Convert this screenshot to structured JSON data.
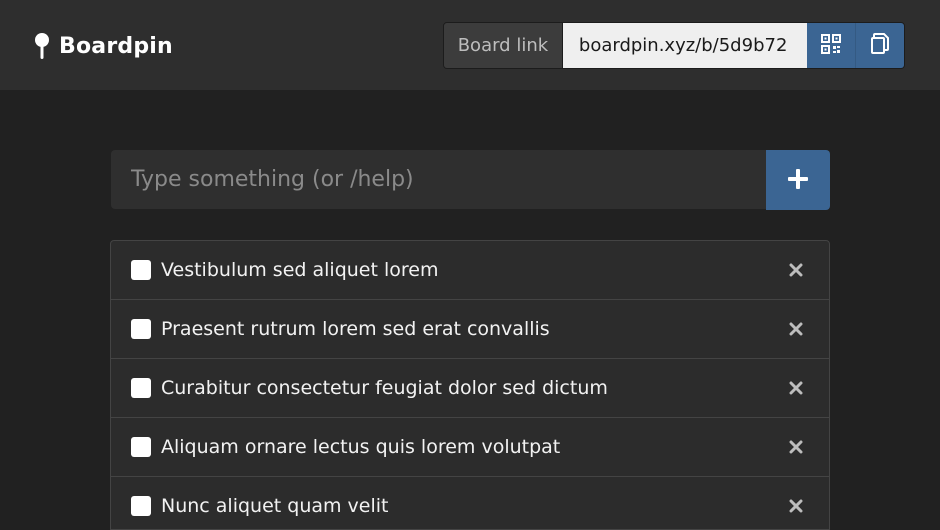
{
  "app": {
    "name": "Boardpin"
  },
  "board_link": {
    "label": "Board link",
    "url": "boardpin.xyz/b/5d9b72",
    "qr_icon": "qr-code-icon",
    "copy_icon": "copy-icon"
  },
  "composer": {
    "placeholder": "Type something (or /help)",
    "add_icon": "plus-icon"
  },
  "items": [
    {
      "text": "Vestibulum sed aliquet lorem",
      "checked": false
    },
    {
      "text": "Praesent rutrum lorem sed erat convallis",
      "checked": false
    },
    {
      "text": "Curabitur consectetur feugiat dolor sed dictum",
      "checked": false
    },
    {
      "text": "Aliquam ornare lectus quis lorem volutpat",
      "checked": false
    },
    {
      "text": "Nunc aliquet quam velit",
      "checked": false
    }
  ],
  "colors": {
    "background": "#212121",
    "navbar": "#2e2e2e",
    "accent": "#3b6593"
  }
}
